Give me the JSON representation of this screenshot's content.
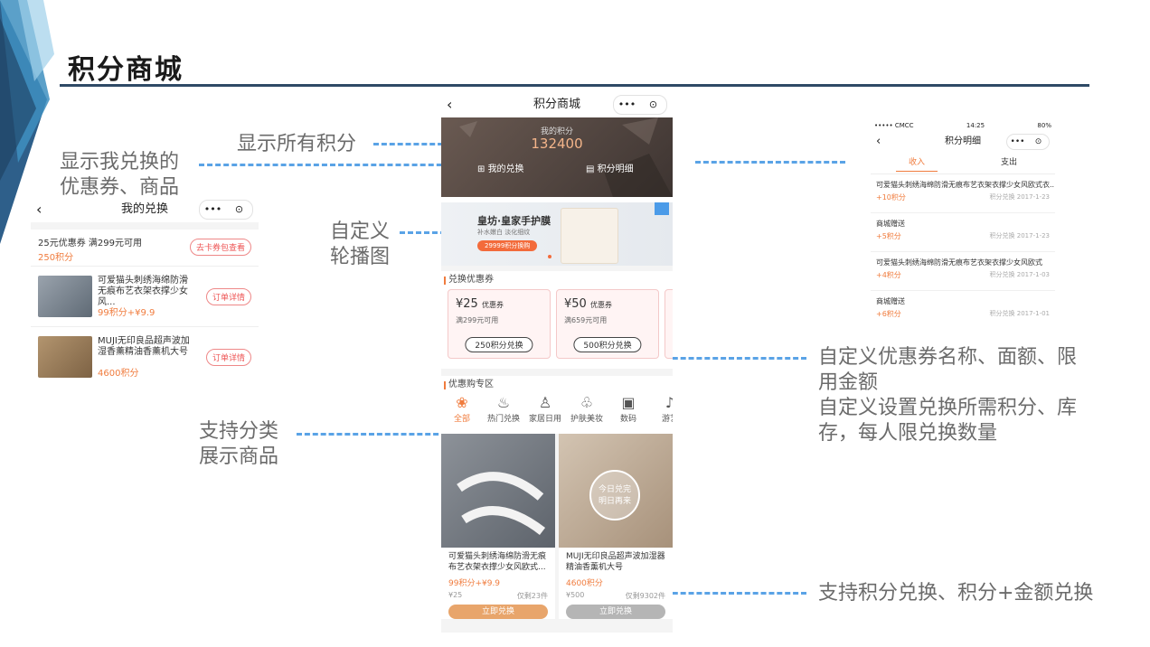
{
  "slide": {
    "title": "积分商城",
    "annotations": {
      "my_exchange": "显示我兑换的\n优惠券、商品",
      "all_points": "显示所有积分",
      "carousel": "自定义\n轮播图",
      "category": "支持分类\n展示商品",
      "coupon_custom": "自定义优惠券名称、面额、限\n用金额\n自定义设置兑换所需积分、库\n存，每人限兑换数量",
      "exchange_mode": "支持积分兑换、积分+金额兑换"
    }
  },
  "exchange_screen": {
    "title": "我的兑换",
    "capsule_more": "•••",
    "capsule_close": "⊙",
    "rows": [
      {
        "title": "25元优惠券 满299元可用",
        "price": "250积分",
        "action": "去卡券包查看"
      },
      {
        "title": "可爱猫头刺绣海绵防滑无痕布艺衣架衣撑少女风...",
        "price": "99积分+¥9.9",
        "action": "订单详情"
      },
      {
        "title": "MUJI无印良品超声波加湿香薰精油香薰机大号",
        "price": "4600积分",
        "action": "订单详情"
      }
    ]
  },
  "main_screen": {
    "title": "积分商城",
    "capsule_more": "•••",
    "capsule_close": "⊙",
    "points_label": "我的积分",
    "points_value": "132400",
    "my_exchange": "我的兑换",
    "points_detail": "积分明细",
    "banner": {
      "title": "皇坊·皇家手护膜",
      "subtitle": "补水嫩白 淡化细纹",
      "badge": "29999积分换购"
    },
    "coupon_section": "兑换优惠券",
    "coupons": [
      {
        "amount": "¥25",
        "unit": "优惠券",
        "condition": "满299元可用",
        "button": "250积分兑换"
      },
      {
        "amount": "¥50",
        "unit": "优惠券",
        "condition": "满659元可用",
        "button": "500积分兑换"
      }
    ],
    "deal_section": "优惠购专区",
    "categories": [
      {
        "icon": "❀",
        "label": "全部"
      },
      {
        "icon": "♨",
        "label": "热门兑换"
      },
      {
        "icon": "♙",
        "label": "家居日用"
      },
      {
        "icon": "♧",
        "label": "护肤美妆"
      },
      {
        "icon": "▣",
        "label": "数码"
      },
      {
        "icon": "♪",
        "label": "游艺"
      }
    ],
    "products": [
      {
        "name": "可爱猫头刺绣海绵防滑无痕布艺衣架衣撑少女风欧式...",
        "points": "99积分+¥9.9",
        "price": "¥25",
        "stock": "仅剩23件",
        "button": "立即兑换"
      },
      {
        "name": "MUJI无印良品超声波加湿器精油香薰机大号",
        "points": "4600积分",
        "price": "¥500",
        "stock": "仅剩9302件",
        "button": "立即兑换",
        "overlay": "今日兑完\n明日再来"
      }
    ]
  },
  "detail_screen": {
    "status_left": "••••• CMCC",
    "status_time": "14:25",
    "status_right": "80%",
    "title": "积分明细",
    "capsule_more": "•••",
    "capsule_close": "⊙",
    "tabs": [
      "收入",
      "支出"
    ],
    "rows": [
      {
        "title": "可爱猫头刺绣海绵防滑无痕布艺衣架衣撑少女风欧式衣...",
        "points": "+10积分",
        "meta": "积分兑换 2017-1-23"
      },
      {
        "title": "商城赠送",
        "points": "+5积分",
        "meta": "积分兑换 2017-1-23"
      },
      {
        "title": "可爱猫头刺绣海绵防滑无痕布艺衣架衣撑少女风欧式",
        "points": "+4积分",
        "meta": "积分兑换 2017-1-03"
      },
      {
        "title": "商城赠送",
        "points": "+6积分",
        "meta": "积分兑换 2017-1-01"
      }
    ]
  },
  "colors": {
    "accent": "#f07c3e",
    "dash": "#5aa3e6",
    "title_rule": "#2f4a66"
  }
}
